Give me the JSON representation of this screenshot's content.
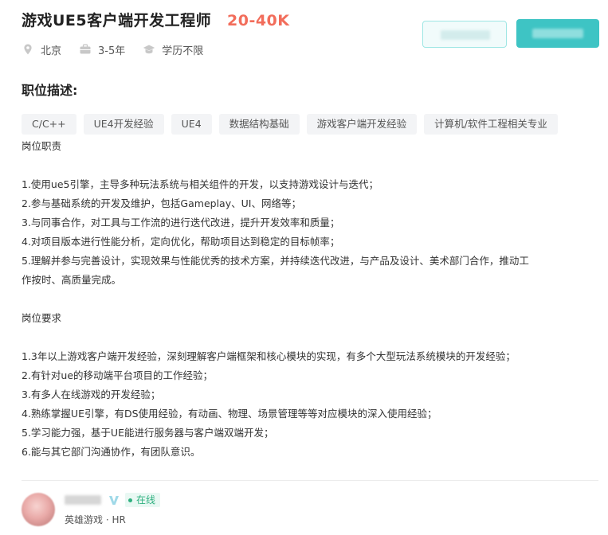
{
  "job": {
    "title": "游戏UE5客户端开发工程师",
    "salary": "20-40K",
    "city": "北京",
    "experience": "3-5年",
    "education": "学历不限"
  },
  "icons": {
    "location": "location-pin-icon",
    "experience": "briefcase-icon",
    "education": "graduation-cap-icon",
    "verified": "verified-v-icon"
  },
  "section": {
    "title": "职位描述:"
  },
  "tags": [
    "C/C++",
    "UE4开发经验",
    "UE4",
    "数据结构基础",
    "游戏客户端开发经验",
    "计算机/软件工程相关专业"
  ],
  "description": {
    "lines": [
      "岗位职责",
      "",
      "1.使用ue5引擎，主导多种玩法系统与相关组件的开发，以支持游戏设计与迭代；",
      "2.参与基础系统的开发及维护，包括Gameplay、UI、网络等；",
      "3.与同事合作，对工具与工作流的进行迭代改进，提升开发效率和质量；",
      "4.对项目版本进行性能分析，定向优化，帮助项目达到稳定的目标帧率；",
      "5.理解并参与完善设计，实现效果与性能优秀的技术方案，并持续迭代改进，与产品及设计、美术部门合作，推动工",
      "作按时、高质量完成。",
      "",
      "岗位要求",
      "",
      "1.3年以上游戏客户端开发经验，深刻理解客户端框架和核心模块的实现，有多个大型玩法系统模块的开发经验；",
      "2.有针对ue的移动端平台项目的工作经验；",
      "3.有多人在线游戏的开发经验；",
      "4.熟练掌握UE引擎，有DS使用经验，有动画、物理、场景管理等等对应模块的深入使用经验；",
      "5.学习能力强，基于UE能进行服务器与客户端双端开发；",
      "6.能与其它部门沟通协作，有团队意识。"
    ]
  },
  "recruiter": {
    "status": "在线",
    "company_role": "英雄游戏 · HR"
  },
  "colors": {
    "salary": "#f26d5b",
    "accent": "#3ec4c4",
    "online": "#2fb07f"
  }
}
